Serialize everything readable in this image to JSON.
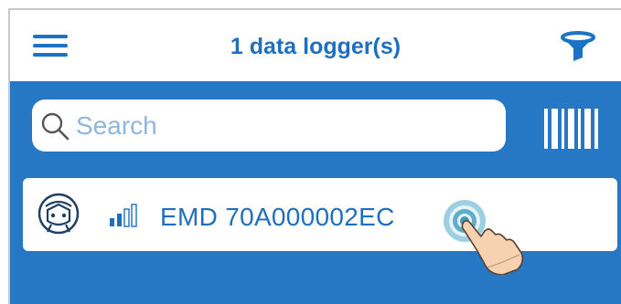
{
  "header": {
    "title": "1 data logger(s)",
    "menu_icon": "hamburger-menu-icon",
    "filter_icon": "funnel-filter-icon"
  },
  "search": {
    "placeholder": "Search",
    "icon": "magnifier-icon"
  },
  "barcode": {
    "icon": "barcode-scan-icon"
  },
  "device_list": [
    {
      "name": "EMD 70A000002EC",
      "avatar_icon": "data-logger-avatar-icon",
      "signal_icon": "signal-strength-icon",
      "signal_bars_active": 2,
      "signal_bars_total": 4
    }
  ],
  "gesture": {
    "icon": "tap-gesture-hand-icon"
  },
  "colors": {
    "accent": "#1f6fbf",
    "background_blue": "#2677c4",
    "placeholder": "#8fb6dd",
    "white": "#ffffff"
  }
}
